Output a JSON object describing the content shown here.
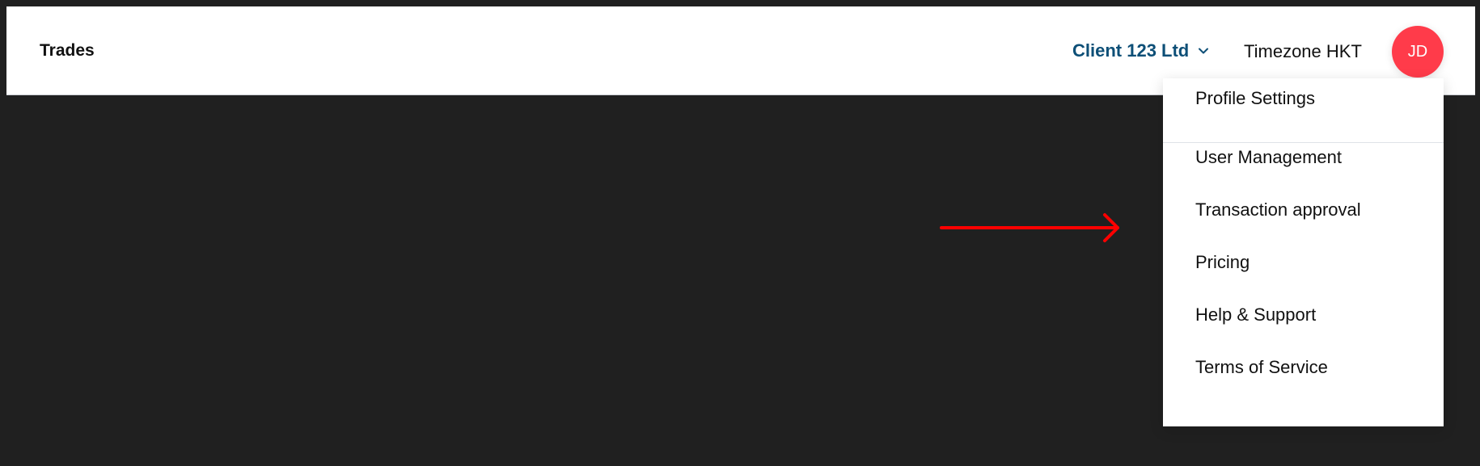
{
  "header": {
    "title": "Trades",
    "client_selector": {
      "label": "Client 123 Ltd",
      "icon": "chevron-down-icon",
      "color": "#0d4f77"
    },
    "timezone": "Timezone HKT",
    "avatar": {
      "initials": "JD",
      "color": "#ff3b4a"
    }
  },
  "user_menu": {
    "items": [
      {
        "label": "Profile Settings"
      },
      {
        "label": "User Management"
      },
      {
        "label": "Transaction approval"
      },
      {
        "label": "Pricing"
      },
      {
        "label": "Help & Support"
      },
      {
        "label": "Terms of Service"
      }
    ]
  },
  "annotation": {
    "type": "arrow-right-icon",
    "color": "#ff0000",
    "points_to": "Transaction approval"
  }
}
